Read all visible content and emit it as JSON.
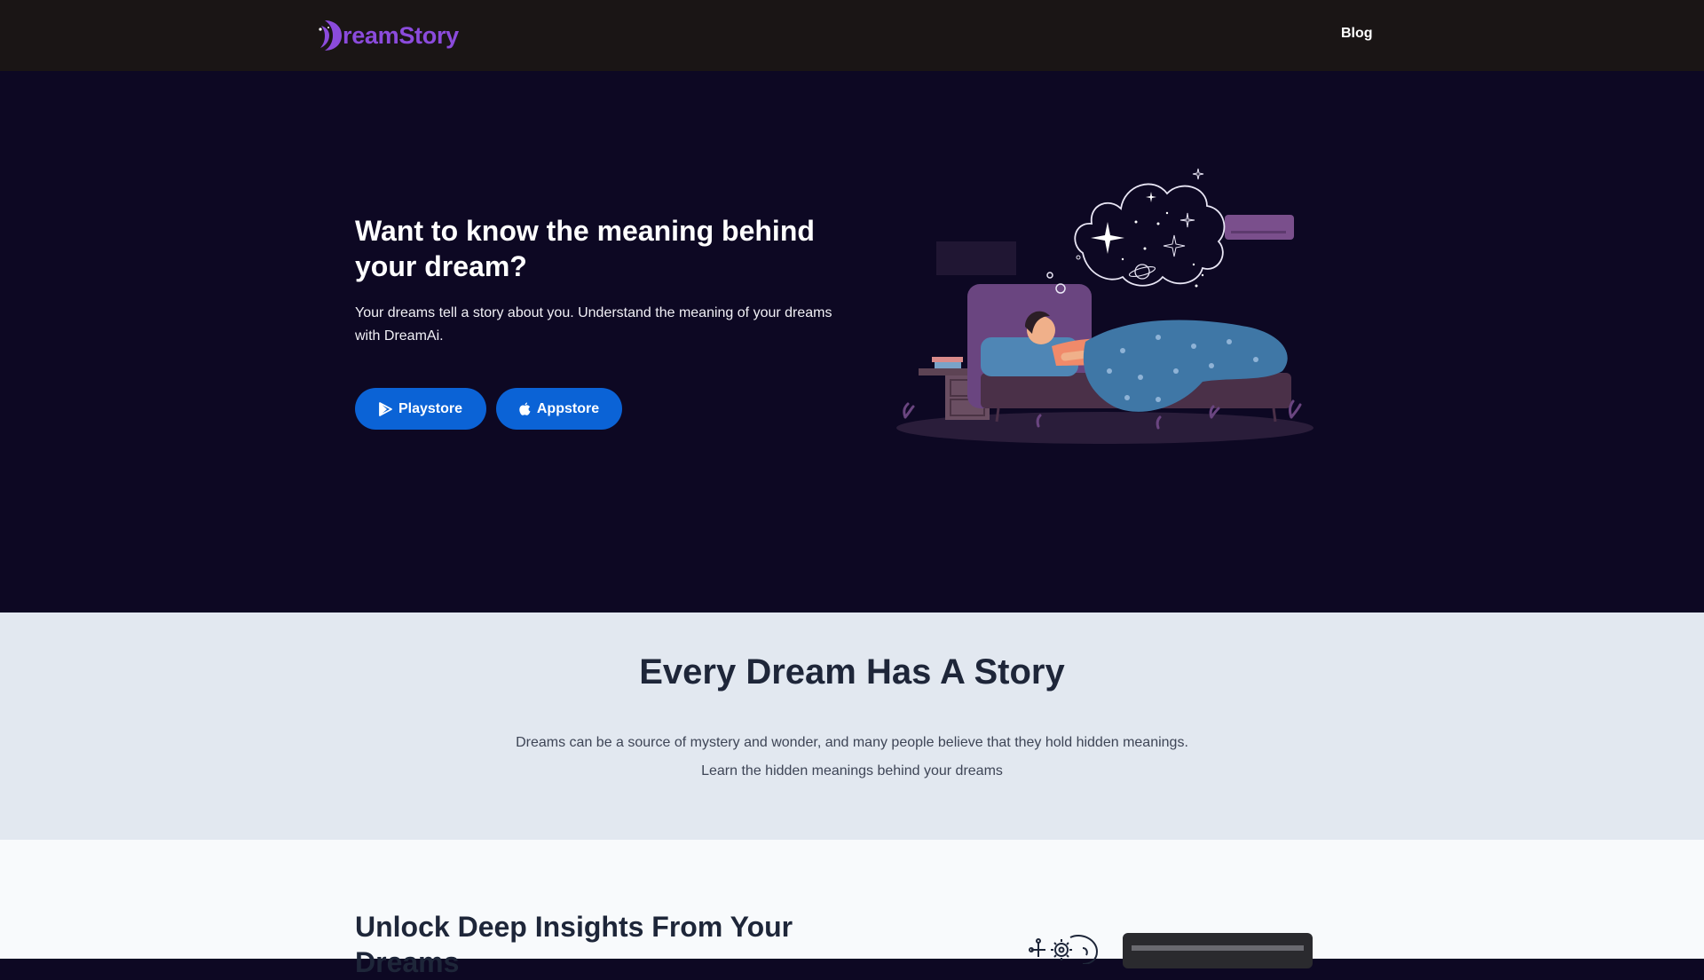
{
  "nav": {
    "logo_text": "reamStory",
    "blog_label": "Blog"
  },
  "hero": {
    "title": "Want to know the meaning behind your dream?",
    "subtitle": "Your dreams tell a story about you. Understand the meaning of your dreams with DreamAi.",
    "playstore_label": "Playstore",
    "appstore_label": "Appstore"
  },
  "story": {
    "title": "Every Dream Has A Story",
    "paragraph_1": "Dreams can be a source of mystery and wonder, and many people believe that they hold hidden meanings.",
    "paragraph_2": "Learn the hidden meanings behind your dreams"
  },
  "insights": {
    "title": "Unlock Deep Insights From Your Dreams"
  },
  "colors": {
    "nav_bg": "#1a1515",
    "hero_bg": "#0d0823",
    "brand_purple": "#8b4bdc",
    "button_blue": "#0b63d6",
    "story_bg": "#e2e8f0",
    "insights_bg": "#f8fafc",
    "heading_dark": "#1e2639"
  },
  "icons": {
    "playstore": "play-triangle-icon",
    "appstore": "apple-icon",
    "logo": "moon-logo-icon"
  }
}
